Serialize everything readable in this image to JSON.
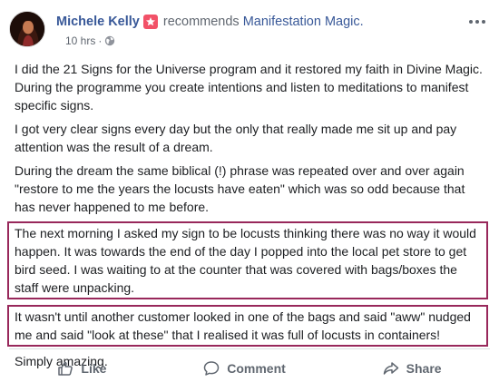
{
  "post": {
    "author": "Michele Kelly",
    "verb": "recommends",
    "page": "Manifestation Magic.",
    "time": "10 hrs",
    "separator": "·",
    "privacy_icon": "globe-icon",
    "more_icon": "more-options-icon",
    "badge_icon": "recommendation-badge-icon",
    "paragraphs": [
      "I did the 21 Signs for the Universe program and it restored my faith in Divine Magic. During the programme you create intentions and listen to meditations to manifest specific signs.",
      "I got very clear signs every day but the only that really made me sit up and pay attention was the result of a dream.",
      "During the dream the same biblical (!) phrase was repeated over and over again \"restore to me the years the locusts have eaten\" which was so odd because that has never happened to me before.",
      "The next morning I asked my sign to be locusts thinking there was no way it would happen. It was towards the end of the day I popped into the local pet store to get bird seed. I was waiting to at the counter that was covered with bags/boxes the staff were unpacking.",
      "It wasn't until another customer looked in one of the bags and said \"aww\" nudged me and said \"look at these\" that I realised it was full of locusts in containers!",
      "Simply amazing."
    ]
  },
  "actions": {
    "like": "Like",
    "comment": "Comment",
    "share": "Share"
  },
  "colors": {
    "link": "#385898",
    "highlight_border": "#98285b",
    "badge": "#f25268",
    "muted": "#606770"
  }
}
